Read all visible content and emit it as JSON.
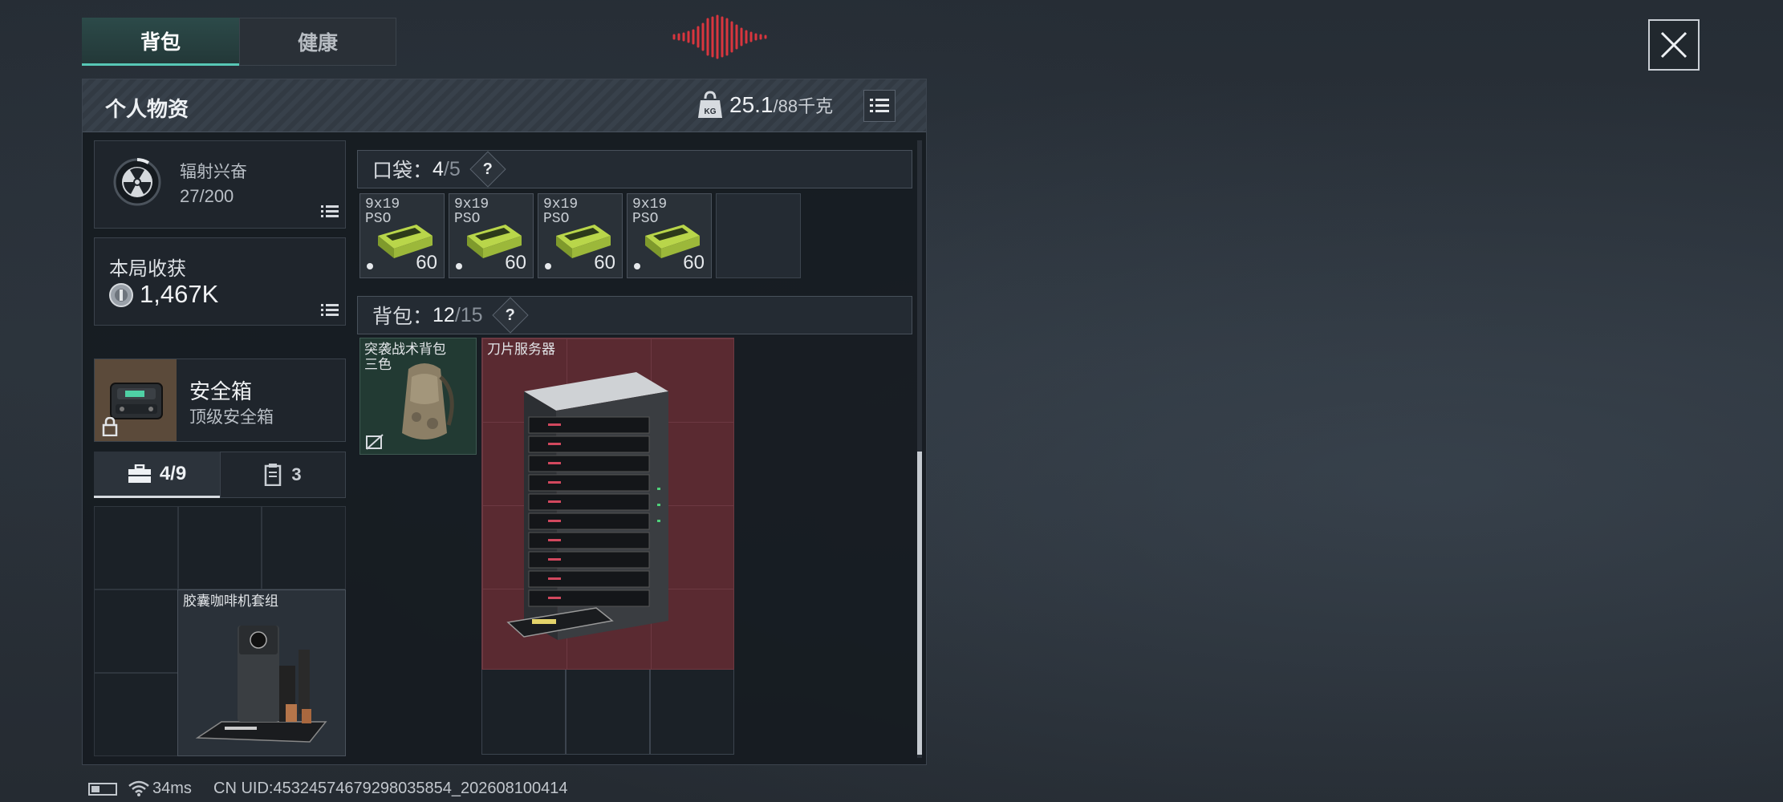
{
  "tabs": [
    {
      "label": "背包",
      "active": true
    },
    {
      "label": "健康",
      "active": false
    }
  ],
  "header": {
    "title": "个人物资",
    "weight_icon_text": "KG",
    "weight_current": "25.1",
    "weight_max": "/88千克"
  },
  "stats": {
    "radiation": {
      "label": "辐射兴奋",
      "value": "27/200"
    },
    "earnings": {
      "label": "本局收获",
      "value": "1,467K"
    }
  },
  "safebox": {
    "title": "安全箱",
    "subtitle": "顶级安全箱"
  },
  "safebox_tabs": [
    {
      "count": "4/9",
      "icon": "briefcase-icon",
      "active": true
    },
    {
      "count": "3",
      "icon": "tablet-icon",
      "active": false
    }
  ],
  "safebox_items": [
    {
      "name": "胶囊咖啡机套组"
    }
  ],
  "pockets": {
    "label": "口袋：",
    "used": "4",
    "total": "/5",
    "help": "?",
    "items": [
      {
        "caliber": "9x19",
        "sub": "PSO",
        "count": "60"
      },
      {
        "caliber": "9x19",
        "sub": "PSO",
        "count": "60"
      },
      {
        "caliber": "9x19",
        "sub": "PSO",
        "count": "60"
      },
      {
        "caliber": "9x19",
        "sub": "PSO",
        "count": "60"
      }
    ]
  },
  "backpack": {
    "label": "背包：",
    "used": "12",
    "total": "/15",
    "help": "?",
    "items": [
      {
        "name": "突袭战术背包",
        "name2": "三色"
      },
      {
        "name": "刀片服务器"
      }
    ]
  },
  "status_bar": {
    "ping": "34ms",
    "uid": "CN UID:45324574679298035854_202608100414"
  },
  "colors": {
    "accent": "#57c7b5",
    "audio_indicator": "#d9363e",
    "server_highlight": "#5a2a31",
    "backpack_bg": "#223a33",
    "safebox_bg": "#5b4a3a"
  }
}
